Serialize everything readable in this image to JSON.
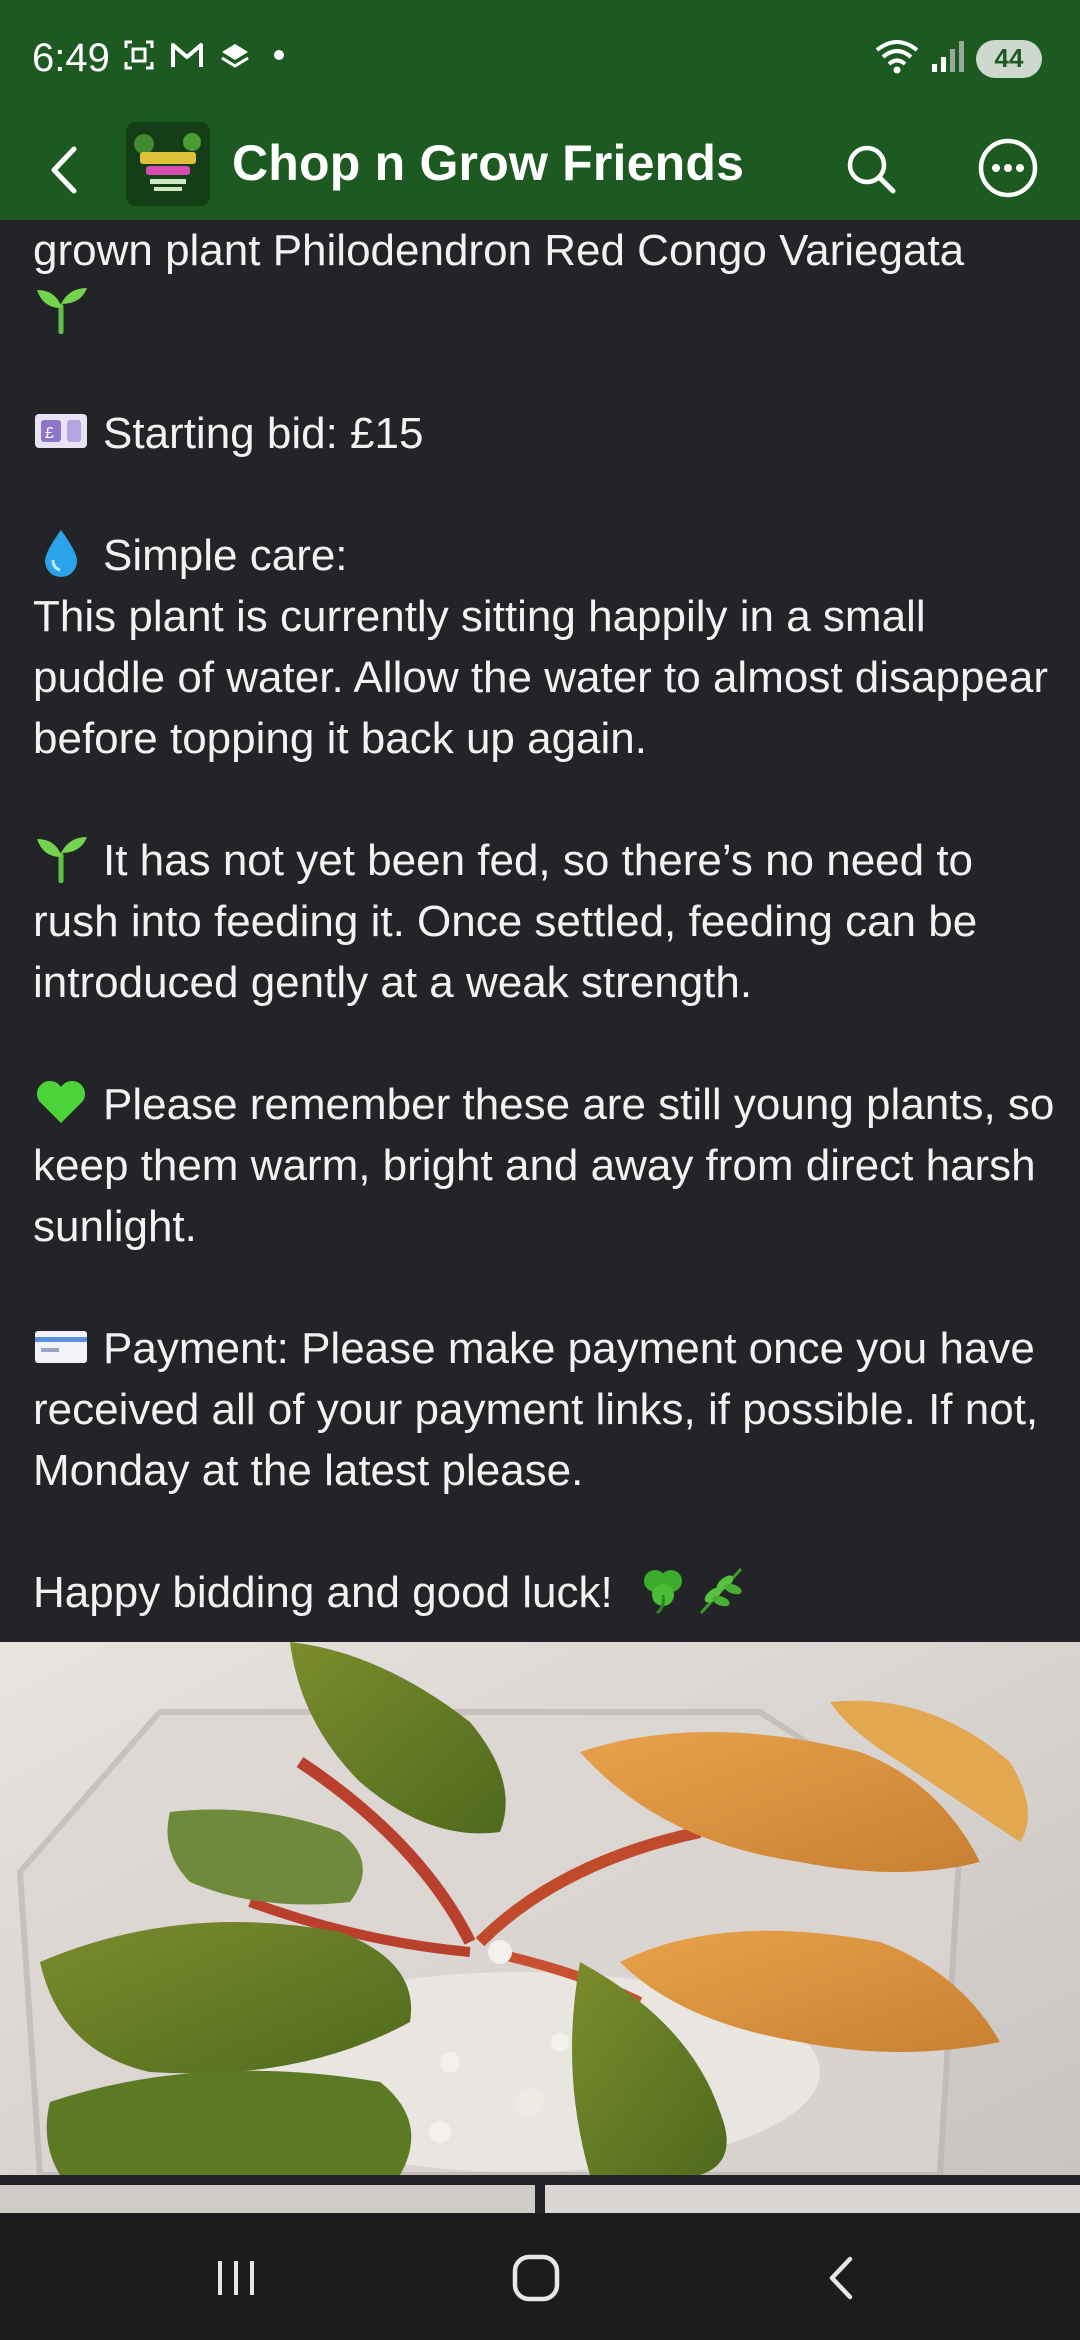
{
  "status_bar": {
    "time": "6:49",
    "battery": "44",
    "icons_left": [
      "screenshot-icon",
      "gmail-icon",
      "layers-icon"
    ],
    "icons_right": [
      "wifi-icon",
      "signal-icon",
      "battery-icon"
    ]
  },
  "app_bar": {
    "title": "Chop n Grow Friends",
    "accent_color": "#1d5a22"
  },
  "post": {
    "intro": "grown plant Philodendron Red Congo Variegata",
    "starting_bid": "Starting bid: £15",
    "care_heading": "Simple care:",
    "care_body": "This plant is currently sitting happily in a small puddle of water. Allow the water to almost disappear before topping it back up again.",
    "feeding": "It has not yet been fed, so there’s no need to rush into feeding it. Once settled, feeding can be introduced gently at a weak strength.",
    "remember": "Please remember these are still young plants, so keep them warm, bright and away from direct harsh sunlight.",
    "payment": "Payment: Please make payment once you have received all of your payment links, if possible. If not, Monday at the latest please.",
    "closing": "Happy bidding and good luck!"
  },
  "emoji_icons": {
    "seedling": "seedling-icon",
    "money": "banknote-icon",
    "droplet": "droplet-icon",
    "heart": "green-heart-icon",
    "card": "credit-card-icon",
    "clover": "clover-icon",
    "herb": "herb-icon"
  }
}
